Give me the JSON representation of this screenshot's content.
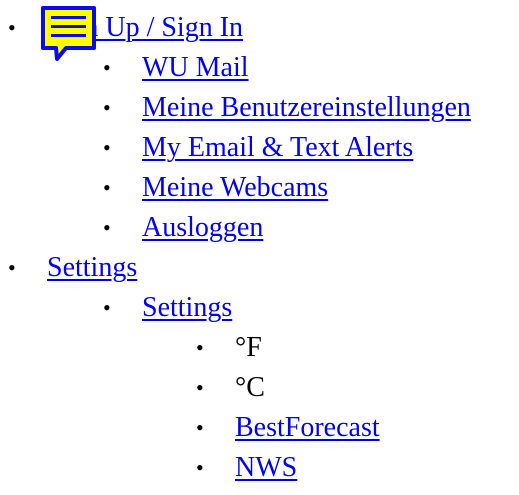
{
  "menu": {
    "account": {
      "label": "Sign Up / Sign In ",
      "icon": "note-icon",
      "items": [
        {
          "label": "WU Mail "
        },
        {
          "label": "Meine Benutzereinstellungen"
        },
        {
          "label": "My Email & Text Alerts"
        },
        {
          "label": "Meine Webcams"
        },
        {
          "label": "Ausloggen"
        }
      ]
    },
    "settings": {
      "label": "Settings ",
      "sub_label": "Settings",
      "options": [
        {
          "label": "°F"
        },
        {
          "label": "°C"
        },
        {
          "label": "BestForecast"
        },
        {
          "label": "NWS"
        }
      ]
    }
  },
  "colors": {
    "link": "#0000ee",
    "note_yellow": "#ffff00",
    "note_stroke": "#0a0aee"
  }
}
